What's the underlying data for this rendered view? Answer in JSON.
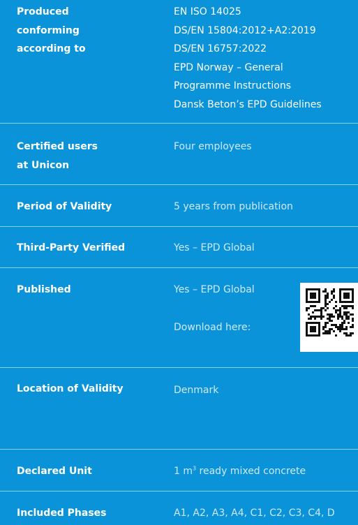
{
  "rows": {
    "produced": {
      "label_lines": [
        "Produced",
        "conforming",
        "according to"
      ],
      "value_lines": [
        "EN ISO 14025",
        "DS/EN 15804:2012+A2:2019",
        "DS/EN 16757:2022",
        "EPD Norway – General",
        "Programme Instructions",
        "Dansk Beton’s EPD Guidelines"
      ]
    },
    "certified": {
      "label_lines": [
        "Certified users",
        "at Unicon"
      ],
      "value": "Four employees"
    },
    "validity_period": {
      "label": "Period of Validity",
      "value": "5 years from publication"
    },
    "third_party": {
      "label": "Third-Party Verified",
      "value": "Yes – EPD Global"
    },
    "published": {
      "label": "Published",
      "value": "Yes – EPD Global",
      "download": "Download here:",
      "qr_icon": "qr-code-icon"
    },
    "location": {
      "label": "Location of Validity",
      "value": "Denmark"
    },
    "declared_unit": {
      "label": "Declared Unit",
      "value_prefix": "1 m",
      "value_sup": "3",
      "value_suffix": " ready mixed concrete"
    },
    "phases": {
      "label": "Included Phases",
      "value": "A1, A2, A3, A4, C1, C2, C3, C4, D"
    }
  },
  "colors": {
    "background": "#0a93d9",
    "label_text": "#ffffff",
    "value_text": "#cfe9f8",
    "divider": "#ffffff"
  }
}
